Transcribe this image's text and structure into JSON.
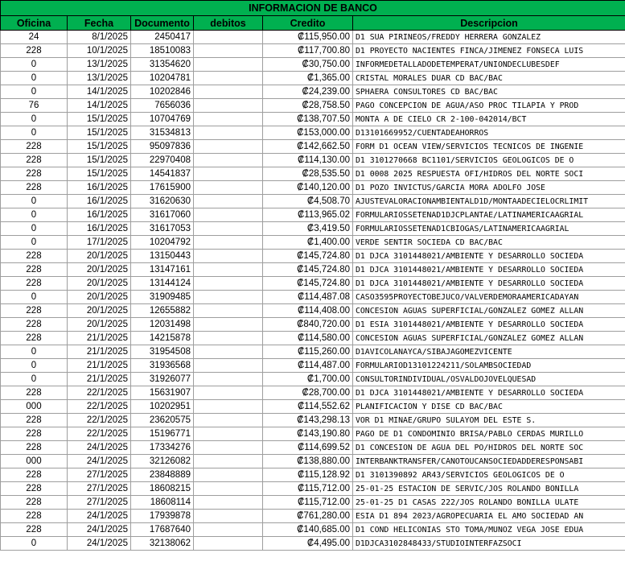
{
  "sheet": {
    "title": "INFORMACION DE BANCO",
    "headers": [
      "Oficina",
      "Fecha",
      "Documento",
      "debitos",
      "Credito",
      "Descripcion"
    ],
    "rows": [
      {
        "oficina": "24",
        "fecha": "8/1/2025",
        "documento": "2450417",
        "debitos": "",
        "credito": "₡115,950.00",
        "descripcion": "D1 SUA PIRINEOS/FREDDY HERRERA GONZALEZ"
      },
      {
        "oficina": "228",
        "fecha": "10/1/2025",
        "documento": "18510083",
        "debitos": "",
        "credito": "₡117,700.80",
        "descripcion": "D1 PROYECTO NACIENTES FINCA/JIMENEZ FONSECA LUIS"
      },
      {
        "oficina": "0",
        "fecha": "13/1/2025",
        "documento": "31354620",
        "debitos": "",
        "credito": "₡30,750.00",
        "descripcion": "INFORMEDETALLADODETEMPERAT/UNIONDECLUBESDEF"
      },
      {
        "oficina": "0",
        "fecha": "13/1/2025",
        "documento": "10204781",
        "debitos": "",
        "credito": "₡1,365.00",
        "descripcion": "CRISTAL MORALES DUAR CD BAC/BAC"
      },
      {
        "oficina": "0",
        "fecha": "14/1/2025",
        "documento": "10202846",
        "debitos": "",
        "credito": "₡24,239.00",
        "descripcion": "SPHAERA CONSULTORES CD BAC/BAC"
      },
      {
        "oficina": "76",
        "fecha": "14/1/2025",
        "documento": "7656036",
        "debitos": "",
        "credito": "₡28,758.50",
        "descripcion": "PAGO CONCEPCION DE AGUA/ASO PROC TILAPIA Y PROD"
      },
      {
        "oficina": "0",
        "fecha": "15/1/2025",
        "documento": "10704769",
        "debitos": "",
        "credito": "₡138,707.50",
        "descripcion": "MONTA A DE CIELO CR 2-100-042014/BCT"
      },
      {
        "oficina": "0",
        "fecha": "15/1/2025",
        "documento": "31534813",
        "debitos": "",
        "credito": "₡153,000.00",
        "descripcion": "D13101669952/CUENTADEAHORROS"
      },
      {
        "oficina": "228",
        "fecha": "15/1/2025",
        "documento": "95097836",
        "debitos": "",
        "credito": "₡142,662.50",
        "descripcion": "FORM D1 OCEAN VIEW/SERVICIOS TECNICOS DE INGENIE"
      },
      {
        "oficina": "228",
        "fecha": "15/1/2025",
        "documento": "22970408",
        "debitos": "",
        "credito": "₡114,130.00",
        "descripcion": "D1 3101270668 BC1101/SERVICIOS GEOLOGICOS DE O"
      },
      {
        "oficina": "228",
        "fecha": "15/1/2025",
        "documento": "14541837",
        "debitos": "",
        "credito": "₡28,535.50",
        "descripcion": "D1 0008 2025 RESPUESTA OFI/HIDROS DEL NORTE SOCI"
      },
      {
        "oficina": "228",
        "fecha": "16/1/2025",
        "documento": "17615900",
        "debitos": "",
        "credito": "₡140,120.00",
        "descripcion": "D1 POZO INVICTUS/GARCIA MORA ADOLFO JOSE"
      },
      {
        "oficina": "0",
        "fecha": "16/1/2025",
        "documento": "31620630",
        "debitos": "",
        "credito": "₡4,508.70",
        "descripcion": "AJUSTEVALORACIONAMBIENTALD1D/MONTAADECIELOCRLIMIT"
      },
      {
        "oficina": "0",
        "fecha": "16/1/2025",
        "documento": "31617060",
        "debitos": "",
        "credito": "₡113,965.02",
        "descripcion": "FORMULARIOSSETENAD1DJCPLANTAE/LATINAMERICAAGRIAL"
      },
      {
        "oficina": "0",
        "fecha": "16/1/2025",
        "documento": "31617053",
        "debitos": "",
        "credito": "₡3,419.50",
        "descripcion": "FORMULARIOSSETENAD1CBIOGAS/LATINAMERICAAGRIAL"
      },
      {
        "oficina": "0",
        "fecha": "17/1/2025",
        "documento": "10204792",
        "debitos": "",
        "credito": "₡1,400.00",
        "descripcion": "VERDE SENTIR SOCIEDA CD BAC/BAC"
      },
      {
        "oficina": "228",
        "fecha": "20/1/2025",
        "documento": "13150443",
        "debitos": "",
        "credito": "₡145,724.80",
        "descripcion": "D1 DJCA 3101448021/AMBIENTE Y DESARROLLO SOCIEDA"
      },
      {
        "oficina": "228",
        "fecha": "20/1/2025",
        "documento": "13147161",
        "debitos": "",
        "credito": "₡145,724.80",
        "descripcion": "D1 DJCA 3101448021/AMBIENTE Y DESARROLLO SOCIEDA"
      },
      {
        "oficina": "228",
        "fecha": "20/1/2025",
        "documento": "13144124",
        "debitos": "",
        "credito": "₡145,724.80",
        "descripcion": "D1 DJCA 3101448021/AMBIENTE Y DESARROLLO SOCIEDA"
      },
      {
        "oficina": "0",
        "fecha": "20/1/2025",
        "documento": "31909485",
        "debitos": "",
        "credito": "₡114,487.08",
        "descripcion": "CASO3595PROYECTOBEJUCO/VALVERDEMORAAMERICADAYAN"
      },
      {
        "oficina": "228",
        "fecha": "20/1/2025",
        "documento": "12655882",
        "debitos": "",
        "credito": "₡114,408.00",
        "descripcion": "CONCESION AGUAS SUPERFICIAL/GONZALEZ GOMEZ ALLAN"
      },
      {
        "oficina": "228",
        "fecha": "20/1/2025",
        "documento": "12031498",
        "debitos": "",
        "credito": "₡840,720.00",
        "descripcion": "D1 ESIA 3101448021/AMBIENTE Y DESARROLLO SOCIEDA"
      },
      {
        "oficina": "228",
        "fecha": "21/1/2025",
        "documento": "14215878",
        "debitos": "",
        "credito": "₡114,580.00",
        "descripcion": "CONCESION AGUAS SUPERFICIAL/GONZALEZ GOMEZ ALLAN"
      },
      {
        "oficina": "0",
        "fecha": "21/1/2025",
        "documento": "31954508",
        "debitos": "",
        "credito": "₡115,260.00",
        "descripcion": "D1AVICOLANAYCA/SIBAJAGOMEZVICENTE"
      },
      {
        "oficina": "0",
        "fecha": "21/1/2025",
        "documento": "31936568",
        "debitos": "",
        "credito": "₡114,487.00",
        "descripcion": "FORMULARIOD13101224211/SOLAMBSOCIEDAD"
      },
      {
        "oficina": "0",
        "fecha": "21/1/2025",
        "documento": "31926077",
        "debitos": "",
        "credito": "₡1,700.00",
        "descripcion": "CONSULTORINDIVIDUAL/OSVALDOJOVELQUESAD"
      },
      {
        "oficina": "228",
        "fecha": "22/1/2025",
        "documento": "15631907",
        "debitos": "",
        "credito": "₡28,700.00",
        "descripcion": "D1 DJCA 3101448021/AMBIENTE Y DESARROLLO SOCIEDA"
      },
      {
        "oficina": "000",
        "fecha": "22/1/2025",
        "documento": "10202951",
        "debitos": "",
        "credito": "₡114,552.62",
        "descripcion": "PLANIFICACION Y DISE CD BAC/BAC"
      },
      {
        "oficina": "228",
        "fecha": "22/1/2025",
        "documento": "23620575",
        "debitos": "",
        "credito": "₡143,298.13",
        "descripcion": "VOR D1 MINAE/GRUPO SULAYOM DEL ESTE S."
      },
      {
        "oficina": "228",
        "fecha": "22/1/2025",
        "documento": "15196771",
        "debitos": "",
        "credito": "₡143,190.80",
        "descripcion": "PAGO DE D1 CONDOMINIO BRISA/PABLO CERDAS MURILLO"
      },
      {
        "oficina": "228",
        "fecha": "24/1/2025",
        "documento": "17334276",
        "debitos": "",
        "credito": "₡114,699.52",
        "descripcion": "D1 CONCESION DE AGUA DEL PO/HIDROS DEL NORTE SOC"
      },
      {
        "oficina": "000",
        "fecha": "24/1/2025",
        "documento": "32126082",
        "debitos": "",
        "credito": "₡138,880.00",
        "descripcion": "INTERBANKTRANSFER/CANOTOUCANSOCIEDADDERESPONSABI"
      },
      {
        "oficina": "228",
        "fecha": "27/1/2025",
        "documento": "23848889",
        "debitos": "",
        "credito": "₡115,128.92",
        "descripcion": "D1 3101390892 AR43/SERVICIOS GEOLOGICOS DE O"
      },
      {
        "oficina": "228",
        "fecha": "27/1/2025",
        "documento": "18608215",
        "debitos": "",
        "credito": "₡115,712.00",
        "descripcion": "25-01-25 ESTACION DE SERVIC/JOS ROLANDO BONILLA"
      },
      {
        "oficina": "228",
        "fecha": "27/1/2025",
        "documento": "18608114",
        "debitos": "",
        "credito": "₡115,712.00",
        "descripcion": "25-01-25 D1 CASAS 222/JOS ROLANDO BONILLA ULATE"
      },
      {
        "oficina": "228",
        "fecha": "24/1/2025",
        "documento": "17939878",
        "debitos": "",
        "credito": "₡761,280.00",
        "descripcion": "ESIA D1 894 2023/AGROPECUARIA EL AMO SOCIEDAD AN"
      },
      {
        "oficina": "228",
        "fecha": "24/1/2025",
        "documento": "17687640",
        "debitos": "",
        "credito": "₡140,685.00",
        "descripcion": "D1 COND HELICONIAS STO TOMA/MUNOZ VEGA JOSE EDUA"
      },
      {
        "oficina": "0",
        "fecha": "24/1/2025",
        "documento": "32138062",
        "debitos": "",
        "credito": "₡4,495.00",
        "descripcion": "D1DJCA3102848433/STUDIOINTERFAZSOCI"
      }
    ]
  }
}
